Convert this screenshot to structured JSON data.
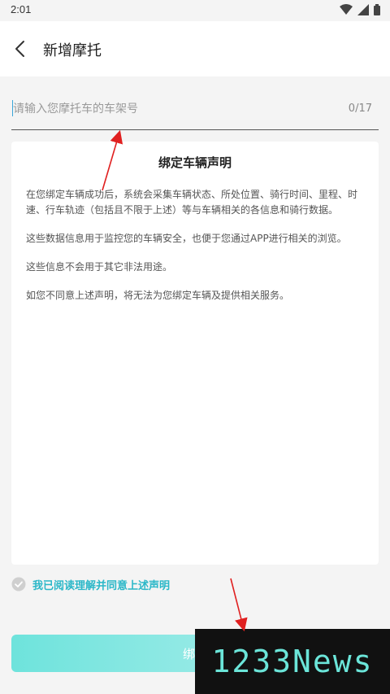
{
  "status_bar": {
    "time": "2:01"
  },
  "header": {
    "title": "新增摩托"
  },
  "frame_input": {
    "placeholder": "请输入您摩托车的车架号",
    "value": "",
    "counter": "0/17"
  },
  "statement": {
    "title": "绑定车辆声明",
    "paragraphs": [
      "在您绑定车辆成功后，系统会采集车辆状态、所处位置、骑行时间、里程、时速、行车轨迹（包括且不限于上述）等与车辆相关的各信息和骑行数据。",
      "这些数据信息用于监控您的车辆安全，也便于您通过APP进行相关的浏览。",
      "这些信息不会用于其它非法用途。",
      "如您不同意上述声明，将无法为您绑定车辆及提供相关服务。"
    ]
  },
  "agreement": {
    "label": "我已阅读理解并同意上述声明",
    "checked": false
  },
  "bind_button": {
    "label": "绑定"
  },
  "watermark": {
    "text": "1233News"
  },
  "colors": {
    "accent": "#2ab7c8",
    "button_start": "#6ee3dc",
    "annotation": "#e02020"
  },
  "icons": [
    "wifi-icon",
    "signal-icon",
    "battery-icon",
    "back-arrow-icon",
    "check-circle-icon"
  ]
}
